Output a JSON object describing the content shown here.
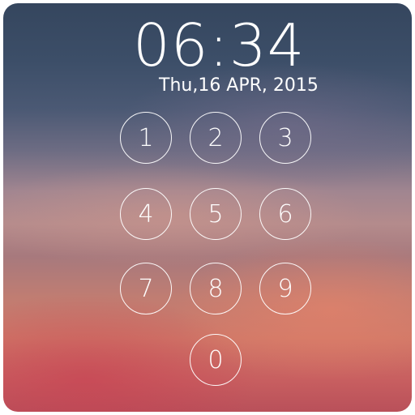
{
  "lockscreen": {
    "time": "06:34",
    "date": "Thu,16 APR, 2015"
  },
  "keypad": {
    "keys": [
      "1",
      "2",
      "3",
      "4",
      "5",
      "6",
      "7",
      "8",
      "9",
      "0"
    ]
  }
}
